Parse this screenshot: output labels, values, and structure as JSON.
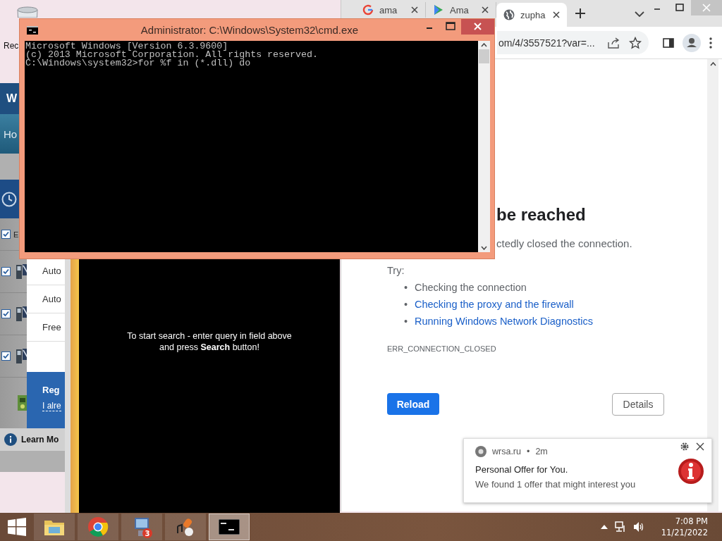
{
  "desktop": {
    "icons": [
      {
        "label": "Rec"
      }
    ]
  },
  "background_app": {
    "header": "W",
    "nav": "Ho",
    "rows": [
      {
        "kind": "text",
        "checked": true,
        "label": "E"
      },
      {
        "kind": "device",
        "checked": true
      },
      {
        "kind": "device",
        "checked": true
      },
      {
        "kind": "device",
        "checked": true
      }
    ],
    "panel_items": [
      "Auto",
      "Auto",
      "Free"
    ],
    "promo": {
      "title": "Reg",
      "link": "I alre"
    },
    "footer": "Learn Mo"
  },
  "search_panel": {
    "lines": [
      "To start search - enter query in field above",
      "and press **Search** button!"
    ]
  },
  "chrome": {
    "tabs": [
      {
        "title": "ama",
        "kind": "google",
        "selected": false
      },
      {
        "title": "Ama",
        "kind": "play",
        "selected": false
      },
      {
        "title": "zupha",
        "kind": "globe",
        "selected": true
      }
    ],
    "address": "om/4/3557521?var=...",
    "page": {
      "heading": "be reached",
      "message": "ctedly closed the connection.",
      "try_label": "Try:",
      "suggestions": [
        {
          "marker": "•",
          "text": "Checking the connection",
          "kind": "plain"
        },
        {
          "marker": "•",
          "text": "Checking the proxy and the firewall",
          "kind": "link"
        },
        {
          "marker": "•",
          "text": "Running Windows Network Diagnostics",
          "kind": "link"
        }
      ],
      "error_code": "ERR_CONNECTION_CLOSED",
      "reload": "Reload",
      "details": "Details"
    }
  },
  "cmd": {
    "title": "Administrator: C:\\Windows\\System32\\cmd.exe",
    "lines": [
      "Microsoft Windows [Version 6.3.9600]",
      "(c) 2013 Microsoft Corporation. All rights reserved.",
      "C:\\Windows\\system32>for %f in (*.dll) do"
    ]
  },
  "notification": {
    "source": "wrsa.ru",
    "separator": "•",
    "time": "2m",
    "title": "Personal Offer for You.",
    "body": "We found 1 offer that might interest you"
  },
  "taskbar": {
    "apps": [
      {
        "kind": "explorer",
        "selected": false
      },
      {
        "kind": "chrome",
        "selected": false
      },
      {
        "kind": "app",
        "selected": false,
        "badge": "3"
      },
      {
        "kind": "media",
        "selected": false
      },
      {
        "kind": "cmd",
        "selected": true
      }
    ],
    "time": "7:08 PM",
    "date": "11/21/2022"
  }
}
